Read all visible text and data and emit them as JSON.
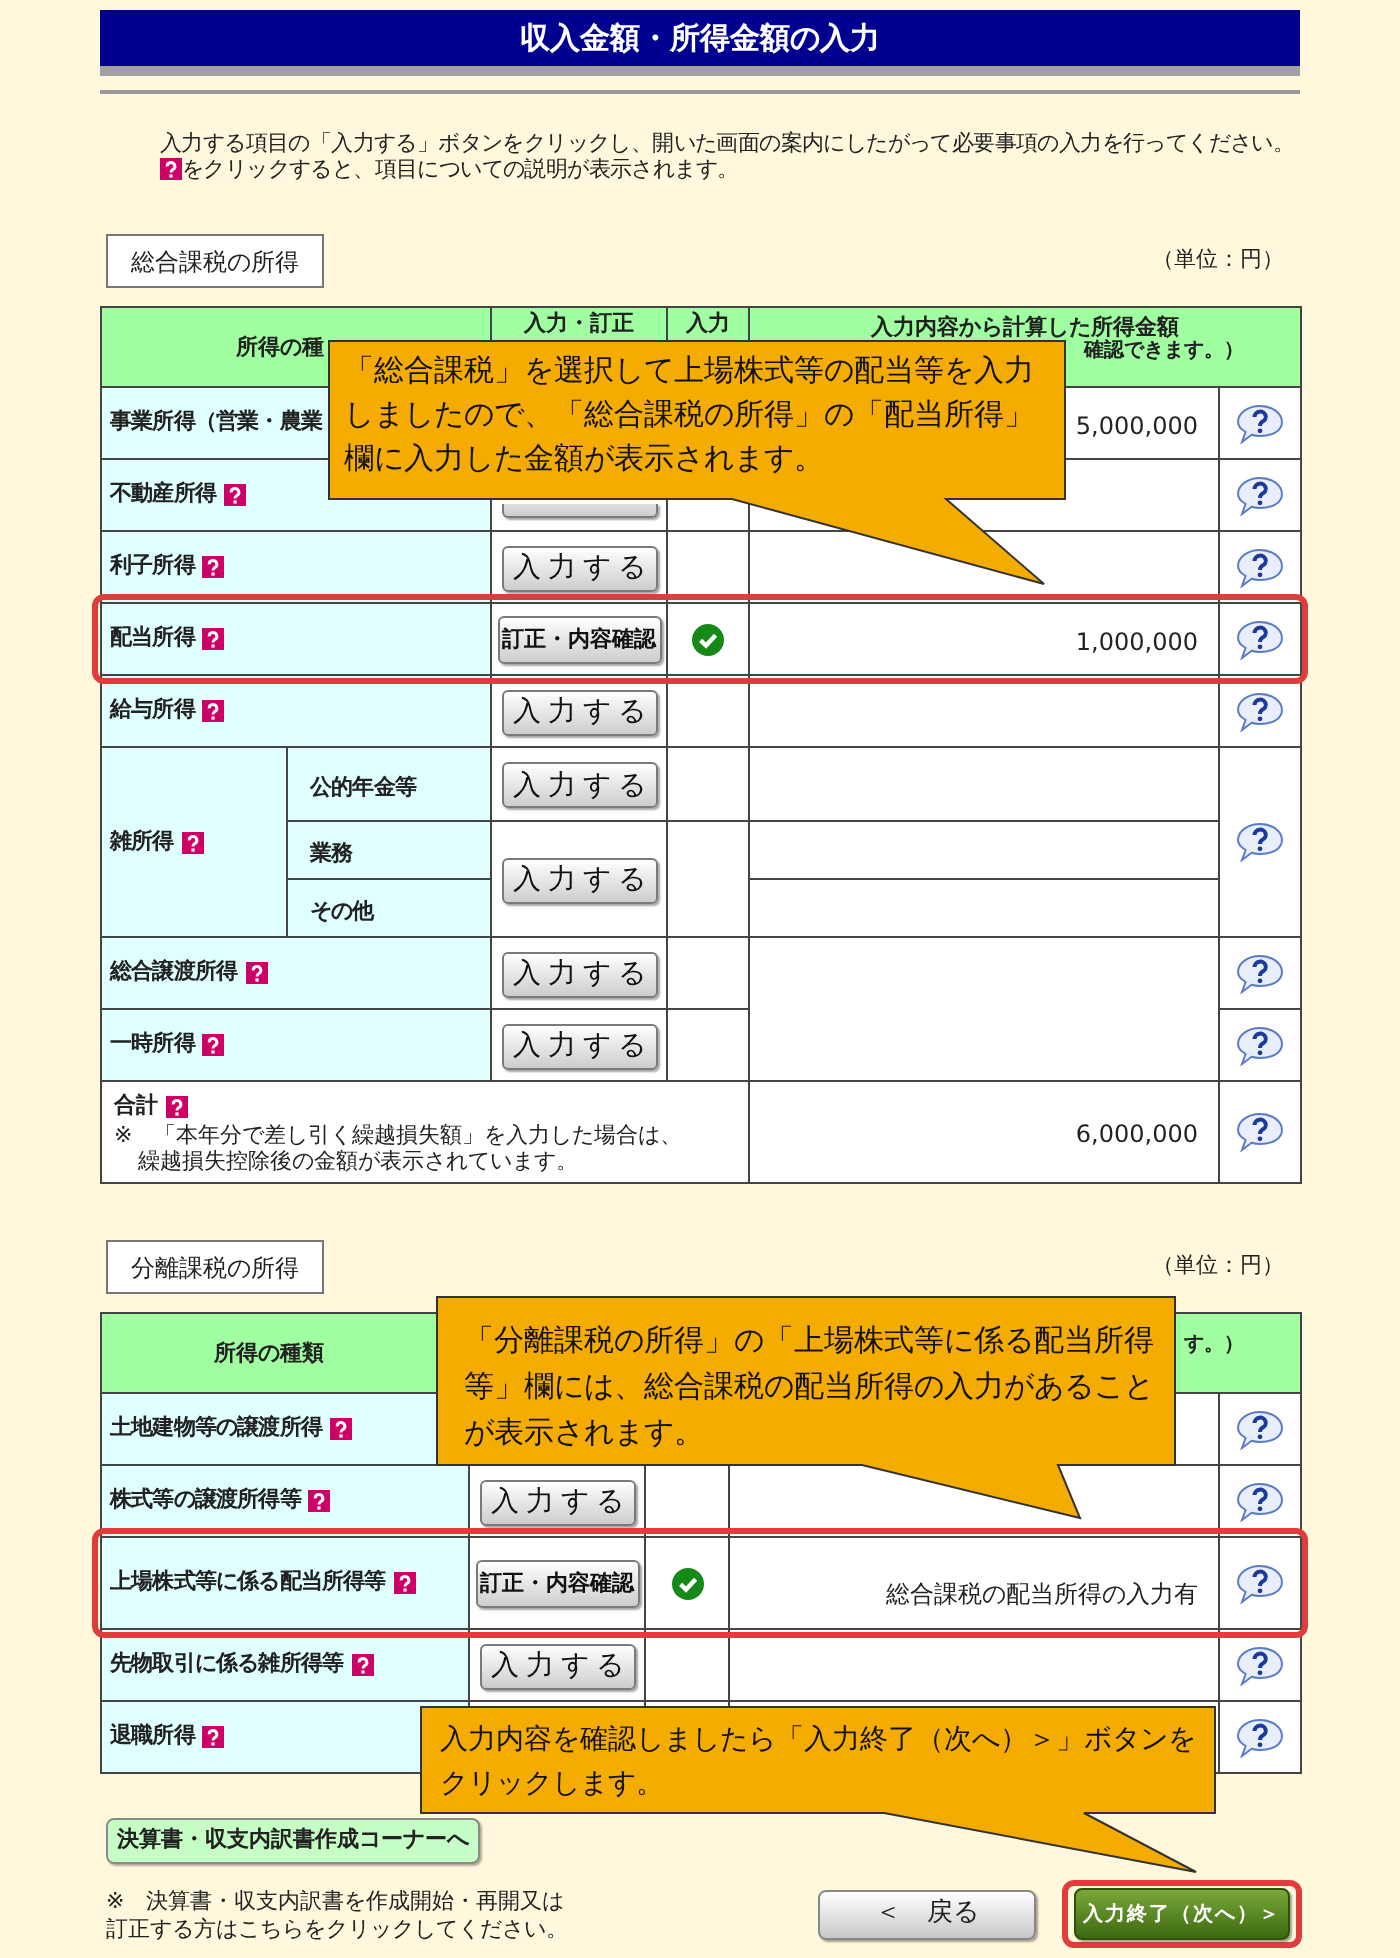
{
  "title": "収入金額・所得金額の入力",
  "instructions": {
    "text": "入力する項目の「入力する」ボタンをクリックし、開いた画面の案内にしたがって必要事項の入力を行ってください。",
    "help_note": "をクリックすると、項目についての説明が表示されます。"
  },
  "sections": [
    {
      "kind": "general",
      "label": "総合課税の所得",
      "unit": "（単位：円）",
      "header": {
        "column_1": "所得の種",
        "column_2": "入力・訂正",
        "column_3": "入力",
        "column_4": {
          "top": "入力内容から計算した所得金額",
          "tail": "確認できます。）"
        }
      },
      "rows": [
        {
          "kind": "partial",
          "label": "事業所得（営業・農業",
          "amount": "5,000,000",
          "highlighted": false
        },
        {
          "kind": "single",
          "label": "不動産所得",
          "button": {
            "kind": "input"
          },
          "done": false,
          "highlighted": false
        },
        {
          "kind": "single",
          "label": "利子所得",
          "button": {
            "kind": "input",
            "label": "入力する"
          },
          "done": false,
          "highlighted": false
        },
        {
          "kind": "single",
          "label": "配当所得",
          "button": {
            "kind": "edit",
            "label": "訂正・内容確認"
          },
          "done": true,
          "amount": "1,000,000",
          "highlighted": true
        },
        {
          "kind": "single",
          "label": "給与所得",
          "button": {
            "kind": "input",
            "label": "入力する"
          },
          "done": false,
          "highlighted": false
        },
        {
          "kind": "group",
          "label": "雑所得",
          "highlighted": false,
          "entries": [
            {
              "button": {
                "kind": "input",
                "label": "入力する"
              },
              "done": false,
              "items": [
                {
                  "label": "公的年金等"
                }
              ]
            },
            {
              "button": {
                "kind": "input",
                "label": "入力する"
              },
              "done": false,
              "items": [
                {
                  "label": "業務"
                },
                {
                  "label": "その他"
                }
              ]
            }
          ]
        },
        {
          "kind": "pair",
          "highlighted": false,
          "items": [
            {
              "label": "総合譲渡所得",
              "button": {
                "kind": "input",
                "label": "入力する"
              },
              "done": false
            },
            {
              "label": "一時所得",
              "button": {
                "kind": "input",
                "label": "入力する"
              },
              "done": false
            }
          ]
        },
        {
          "kind": "total",
          "label": "合計",
          "note": "※　「本年分で差し引く繰越損失額」を入力した場合は、繰越損失控除後の金額が表示されています。",
          "amount": "6,000,000",
          "highlighted": false
        }
      ]
    },
    {
      "kind": "separate",
      "label": "分離課税の所得",
      "unit": "（単位：円）",
      "header": {
        "column_1": "所得の種類",
        "column_4": {
          "tail": "す。）"
        }
      },
      "rows": [
        {
          "kind": "single",
          "label": "土地建物等の譲渡所得",
          "highlighted": false
        },
        {
          "kind": "single",
          "label": "株式等の譲渡所得等",
          "button": {
            "kind": "input",
            "label": "入力する"
          },
          "done": false,
          "highlighted": false
        },
        {
          "kind": "single",
          "label": "上場株式等に係る配当所得等",
          "button": {
            "kind": "edit",
            "label": "訂正・内容確認"
          },
          "done": true,
          "amount": "総合課税の配当所得の入力有",
          "highlighted": true
        },
        {
          "kind": "single",
          "label": "先物取引に係る雑所得等",
          "button": {
            "kind": "input",
            "label": "入力する"
          },
          "done": false,
          "highlighted": false
        },
        {
          "kind": "single",
          "label": "退職所得",
          "highlighted": false
        }
      ]
    }
  ],
  "corner_button": {
    "label": "決算書・収支内訳書作成コーナーへ"
  },
  "corner_note": "※　決算書・収支内訳書を作成開始・再開又は訂正する方はこちらをクリックしてください。",
  "nav_buttons": [
    {
      "kind": "back",
      "label": "＜　戻る",
      "highlighted": false
    },
    {
      "kind": "next",
      "label": "入力終了（次へ）＞",
      "highlighted": true
    }
  ],
  "callouts": [
    {
      "text": "「総合課税」を選択して上場株式等の配当等を入力しましたので、「総合課税の所得」の「配当所得」欄に入力した金額が表示されます。"
    },
    {
      "text": "「分離課税の所得」の「上場株式等に係る配当所得等」欄には、総合課税の配当所得の入力があることが表示されます。"
    },
    {
      "text": "入力内容を確認しましたら「入力終了（次へ）＞」ボタンをクリックします。"
    }
  ]
}
